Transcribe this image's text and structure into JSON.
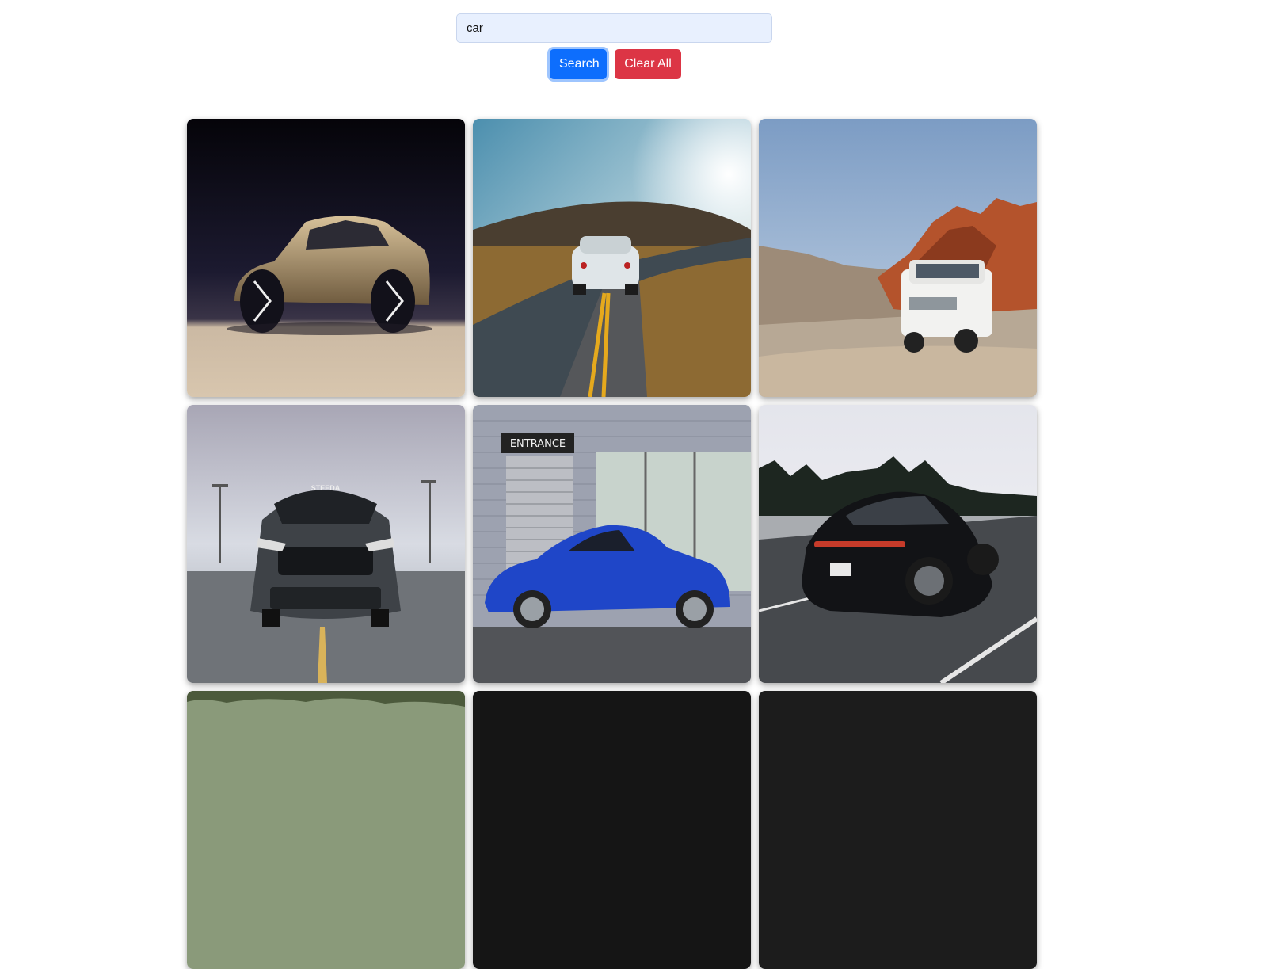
{
  "search": {
    "value": "car",
    "placeholder": ""
  },
  "buttons": {
    "search_label": "Search",
    "clear_label": "Clear All"
  },
  "colors": {
    "search_button": "#0d6efd",
    "clear_button": "#dc3545",
    "input_background": "#e8f0fe"
  },
  "gallery": {
    "photos": [
      {
        "subject": "gold concept car sketch on dark background"
      },
      {
        "subject": "white sports car on winding desert road at sunset"
      },
      {
        "subject": "white SUV on dirt road beside red rocks"
      },
      {
        "subject": "dark grey muscle car front view on wet pavement",
        "text": "STEEDA"
      },
      {
        "subject": "blue coupe parked in front of building entrance",
        "text": "ENTRANCE"
      },
      {
        "subject": "black sedan driving on highway"
      },
      {
        "subject": "photo partially visible (trees)"
      },
      {
        "subject": "photo partially visible (dark)"
      },
      {
        "subject": "photo partially visible (dark)"
      }
    ]
  }
}
